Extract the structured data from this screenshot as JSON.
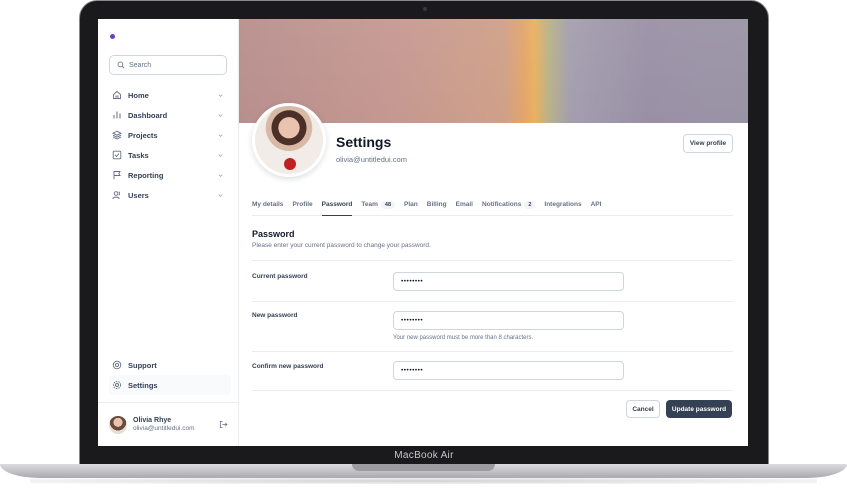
{
  "device": {
    "label": "MacBook Air"
  },
  "search": {
    "placeholder": "Search"
  },
  "nav": {
    "items": [
      {
        "label": "Home",
        "icon": "home-icon"
      },
      {
        "label": "Dashboard",
        "icon": "bar-chart-icon"
      },
      {
        "label": "Projects",
        "icon": "layers-icon"
      },
      {
        "label": "Tasks",
        "icon": "check-square-icon"
      },
      {
        "label": "Reporting",
        "icon": "flag-icon"
      },
      {
        "label": "Users",
        "icon": "users-icon"
      }
    ],
    "bottom": [
      {
        "label": "Support",
        "icon": "life-buoy-icon"
      },
      {
        "label": "Settings",
        "icon": "gear-icon"
      }
    ]
  },
  "user": {
    "name": "Olivia Rhye",
    "email": "olivia@untitledui.com"
  },
  "header": {
    "title": "Settings",
    "email": "olivia@untitledui.com",
    "view_profile_label": "View profile"
  },
  "tabs": [
    {
      "label": "My details"
    },
    {
      "label": "Profile"
    },
    {
      "label": "Password",
      "active": true
    },
    {
      "label": "Team",
      "badge": "48"
    },
    {
      "label": "Plan"
    },
    {
      "label": "Billing"
    },
    {
      "label": "Email"
    },
    {
      "label": "Notifications",
      "badge": "2"
    },
    {
      "label": "Integrations"
    },
    {
      "label": "API"
    }
  ],
  "password_section": {
    "title": "Password",
    "description": "Please enter your current password to change your password.",
    "current_label": "Current password",
    "current_value": "••••••••",
    "new_label": "New password",
    "new_value": "••••••••",
    "new_hint": "Your new password must be more than 8 characters.",
    "confirm_label": "Confirm new password",
    "confirm_value": "••••••••",
    "cancel_label": "Cancel",
    "update_label": "Update password"
  },
  "colors": {
    "accent": "#6941c6",
    "primary_button": "#344054",
    "border": "#d0d5dd"
  }
}
